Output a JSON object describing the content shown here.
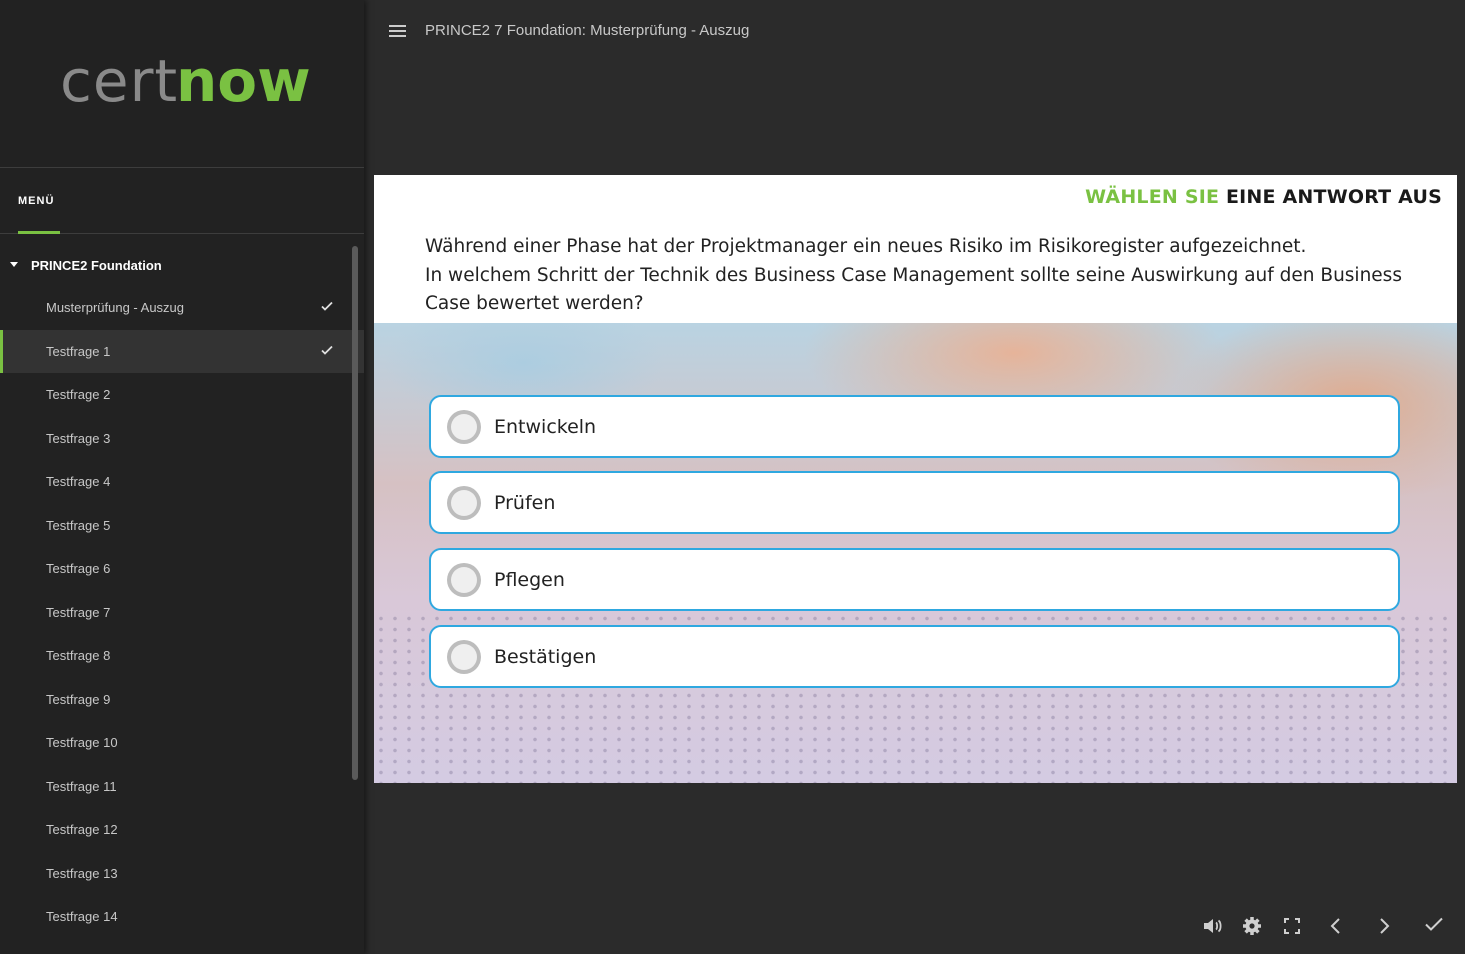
{
  "brand": {
    "logo_part1": "cert",
    "logo_part2": "now",
    "accent": "#7ac142"
  },
  "sidebar": {
    "menu_label": "MENÜ",
    "course_title": "PRINCE2 Foundation",
    "items": [
      {
        "label": "Musterprüfung - Auszug",
        "completed": true,
        "active": false
      },
      {
        "label": "Testfrage 1",
        "completed": true,
        "active": true
      },
      {
        "label": "Testfrage 2",
        "completed": false,
        "active": false
      },
      {
        "label": "Testfrage 3",
        "completed": false,
        "active": false
      },
      {
        "label": "Testfrage 4",
        "completed": false,
        "active": false
      },
      {
        "label": "Testfrage 5",
        "completed": false,
        "active": false
      },
      {
        "label": "Testfrage 6",
        "completed": false,
        "active": false
      },
      {
        "label": "Testfrage 7",
        "completed": false,
        "active": false
      },
      {
        "label": "Testfrage 8",
        "completed": false,
        "active": false
      },
      {
        "label": "Testfrage 9",
        "completed": false,
        "active": false
      },
      {
        "label": "Testfrage 10",
        "completed": false,
        "active": false
      },
      {
        "label": "Testfrage 11",
        "completed": false,
        "active": false
      },
      {
        "label": "Testfrage 12",
        "completed": false,
        "active": false
      },
      {
        "label": "Testfrage 13",
        "completed": false,
        "active": false
      },
      {
        "label": "Testfrage 14",
        "completed": false,
        "active": false
      }
    ]
  },
  "header": {
    "title": "PRINCE2 7 Foundation: Musterprüfung - Auszug"
  },
  "slide": {
    "instruction_highlight": "WÄHLEN SIE",
    "instruction_rest": "EINE ANTWORT AUS",
    "question_line1": "Während einer Phase hat der Projektmanager ein neues Risiko im Risikoregister aufgezeichnet.",
    "question_line2": "In welchem Schritt der Technik des Business Case Management sollte seine Auswirkung auf den Business Case bewertet werden?",
    "answers": [
      {
        "label": "Entwickeln"
      },
      {
        "label": "Prüfen"
      },
      {
        "label": "Pflegen"
      },
      {
        "label": "Bestätigen"
      }
    ]
  },
  "controls": {
    "icons": [
      "volume-icon",
      "settings-icon",
      "fullscreen-icon",
      "previous-icon",
      "next-icon",
      "submit-check-icon"
    ]
  }
}
